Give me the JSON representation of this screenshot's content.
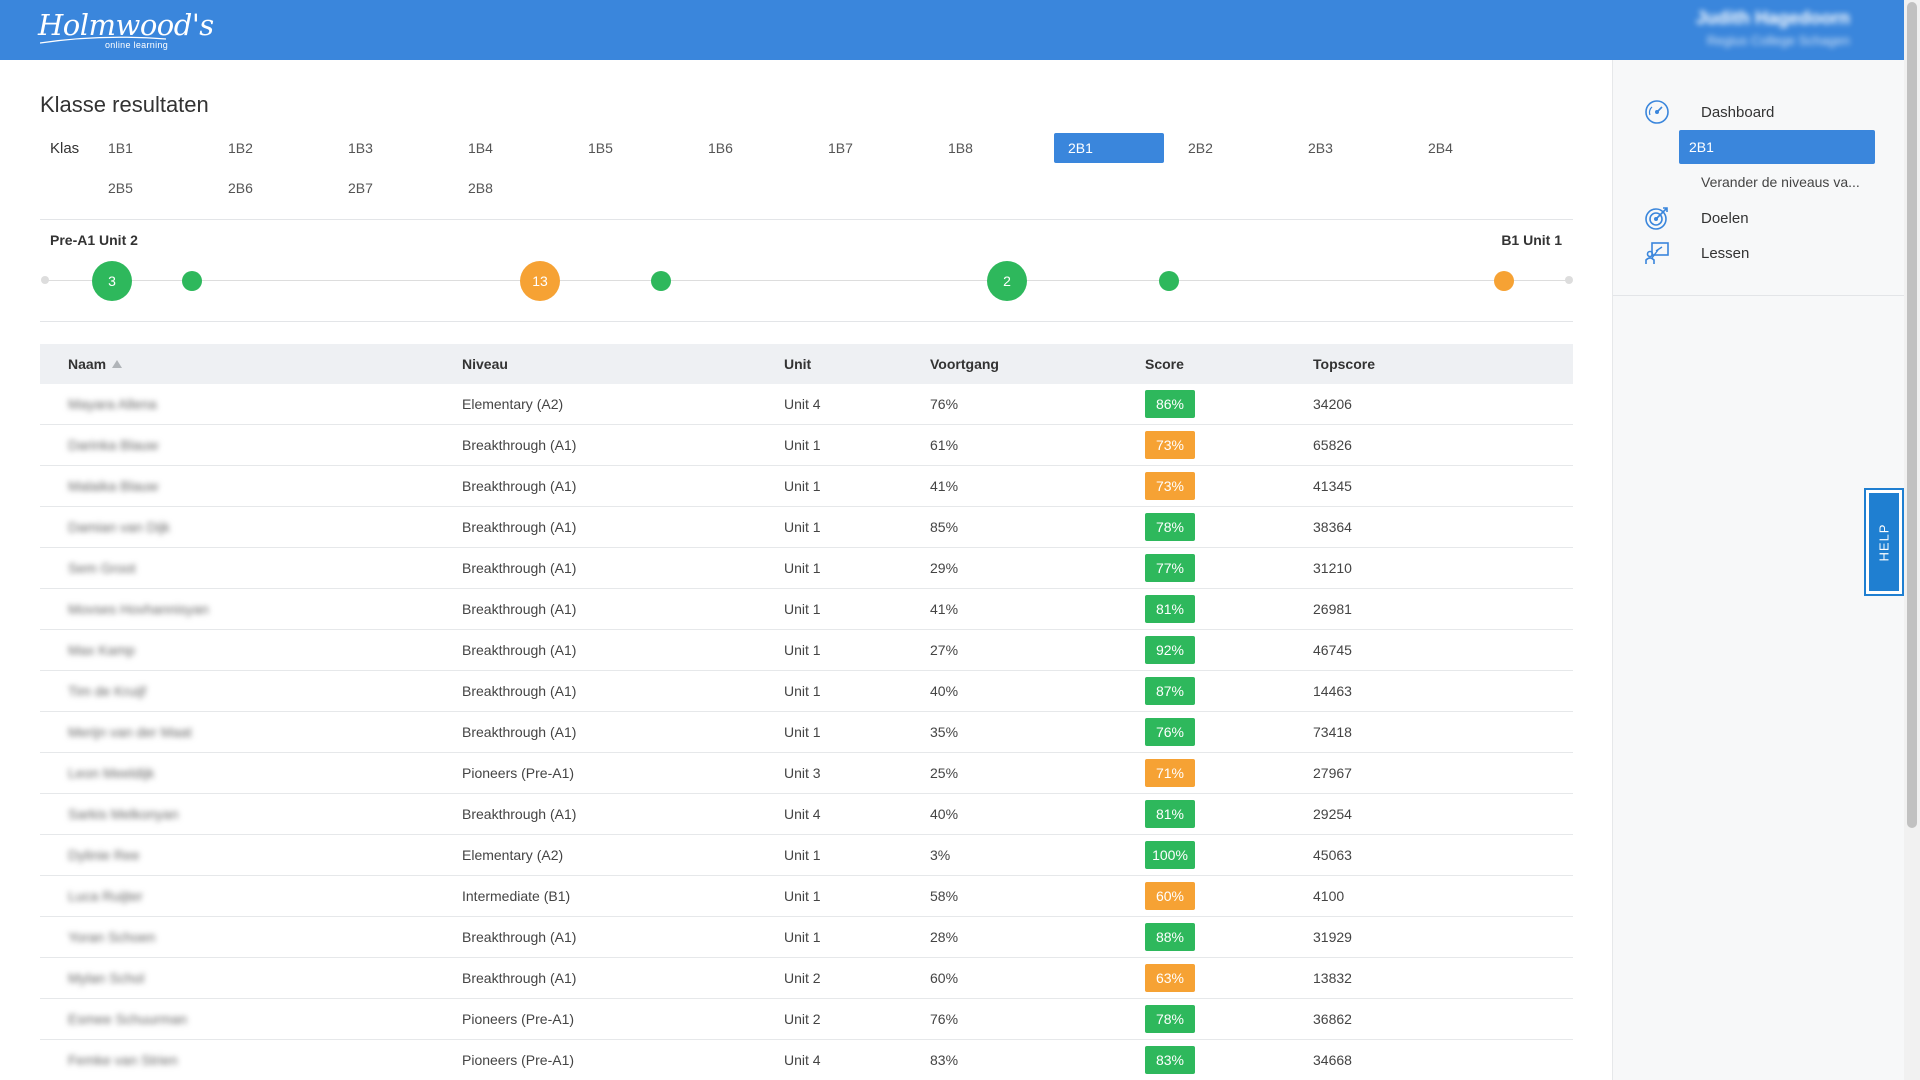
{
  "header": {
    "logo_text": "Holmwood's",
    "logo_sub": "online learning",
    "user_name": "Judith Hagedoorn",
    "user_school": "Regius College Schagen"
  },
  "colors": {
    "primary": "#3a86dc",
    "green": "#2eb85c",
    "orange": "#f6a234",
    "help": "#1f7fd1"
  },
  "page": {
    "title": "Klasse resultaten",
    "klas_label": "Klas"
  },
  "classes": [
    "1B1",
    "1B2",
    "1B3",
    "1B4",
    "1B5",
    "1B6",
    "1B7",
    "1B8",
    "2B1",
    "2B2",
    "2B3",
    "2B4",
    "2B5",
    "2B6",
    "2B7",
    "2B8"
  ],
  "selected_class": "2B1",
  "progress": {
    "start_label": "Pre-A1 Unit 2",
    "end_label": "B1 Unit 1",
    "markers": [
      {
        "count": "3",
        "status": "green"
      },
      {
        "count": "",
        "status": "green"
      },
      {
        "count": "13",
        "status": "orange"
      },
      {
        "count": "",
        "status": "green"
      },
      {
        "count": "2",
        "status": "green"
      },
      {
        "count": "",
        "status": "green"
      },
      {
        "count": "",
        "status": "orange"
      }
    ]
  },
  "sidebar": {
    "dashboard": "Dashboard",
    "active_class": "2B1",
    "change_levels": "Verander de niveaus va...",
    "goals": "Doelen",
    "lessons": "Lessen"
  },
  "help_label": "HELP",
  "table": {
    "headers": {
      "name": "Naam",
      "level": "Niveau",
      "unit": "Unit",
      "progress": "Voortgang",
      "score": "Score",
      "topscore": "Topscore"
    },
    "rows": [
      {
        "name": "Mayara Allena",
        "level": "Elementary (A2)",
        "unit": "Unit 4",
        "progress": "76%",
        "score": "86%",
        "score_status": "green",
        "topscore": "34206"
      },
      {
        "name": "Darinka Blauw",
        "level": "Breakthrough (A1)",
        "unit": "Unit 1",
        "progress": "61%",
        "score": "73%",
        "score_status": "orange",
        "topscore": "65826"
      },
      {
        "name": "Malaika Blauw",
        "level": "Breakthrough (A1)",
        "unit": "Unit 1",
        "progress": "41%",
        "score": "73%",
        "score_status": "orange",
        "topscore": "41345"
      },
      {
        "name": "Damian van Dijk",
        "level": "Breakthrough (A1)",
        "unit": "Unit 1",
        "progress": "85%",
        "score": "78%",
        "score_status": "green",
        "topscore": "38364"
      },
      {
        "name": "Sem Groot",
        "level": "Breakthrough (A1)",
        "unit": "Unit 1",
        "progress": "29%",
        "score": "77%",
        "score_status": "green",
        "topscore": "31210"
      },
      {
        "name": "Movses Hovhannisyan",
        "level": "Breakthrough (A1)",
        "unit": "Unit 1",
        "progress": "41%",
        "score": "81%",
        "score_status": "green",
        "topscore": "26981"
      },
      {
        "name": "Max Kamp",
        "level": "Breakthrough (A1)",
        "unit": "Unit 1",
        "progress": "27%",
        "score": "92%",
        "score_status": "green",
        "topscore": "46745"
      },
      {
        "name": "Tim de Kruijf",
        "level": "Breakthrough (A1)",
        "unit": "Unit 1",
        "progress": "40%",
        "score": "87%",
        "score_status": "green",
        "topscore": "14463"
      },
      {
        "name": "Merijn van der Maat",
        "level": "Breakthrough (A1)",
        "unit": "Unit 1",
        "progress": "35%",
        "score": "76%",
        "score_status": "green",
        "topscore": "73418"
      },
      {
        "name": "Leon Meeldijk",
        "level": "Pioneers (Pre-A1)",
        "unit": "Unit 3",
        "progress": "25%",
        "score": "71%",
        "score_status": "orange",
        "topscore": "27967"
      },
      {
        "name": "Sarkis Melkonyan",
        "level": "Breakthrough (A1)",
        "unit": "Unit 4",
        "progress": "40%",
        "score": "81%",
        "score_status": "green",
        "topscore": "29254"
      },
      {
        "name": "Dylinie Ree",
        "level": "Elementary (A2)",
        "unit": "Unit 1",
        "progress": "3%",
        "score": "100%",
        "score_status": "green",
        "topscore": "45063"
      },
      {
        "name": "Luca Ruijter",
        "level": "Intermediate (B1)",
        "unit": "Unit 1",
        "progress": "58%",
        "score": "60%",
        "score_status": "orange",
        "topscore": "4100"
      },
      {
        "name": "Yoran Schoen",
        "level": "Breakthrough (A1)",
        "unit": "Unit 1",
        "progress": "28%",
        "score": "88%",
        "score_status": "green",
        "topscore": "31929"
      },
      {
        "name": "Mylan Schol",
        "level": "Breakthrough (A1)",
        "unit": "Unit 2",
        "progress": "60%",
        "score": "63%",
        "score_status": "orange",
        "topscore": "13832"
      },
      {
        "name": "Esmee Schuurman",
        "level": "Pioneers (Pre-A1)",
        "unit": "Unit 2",
        "progress": "76%",
        "score": "78%",
        "score_status": "green",
        "topscore": "36862"
      },
      {
        "name": "Femke van Strien",
        "level": "Pioneers (Pre-A1)",
        "unit": "Unit 4",
        "progress": "83%",
        "score": "83%",
        "score_status": "green",
        "topscore": "34668"
      }
    ]
  }
}
